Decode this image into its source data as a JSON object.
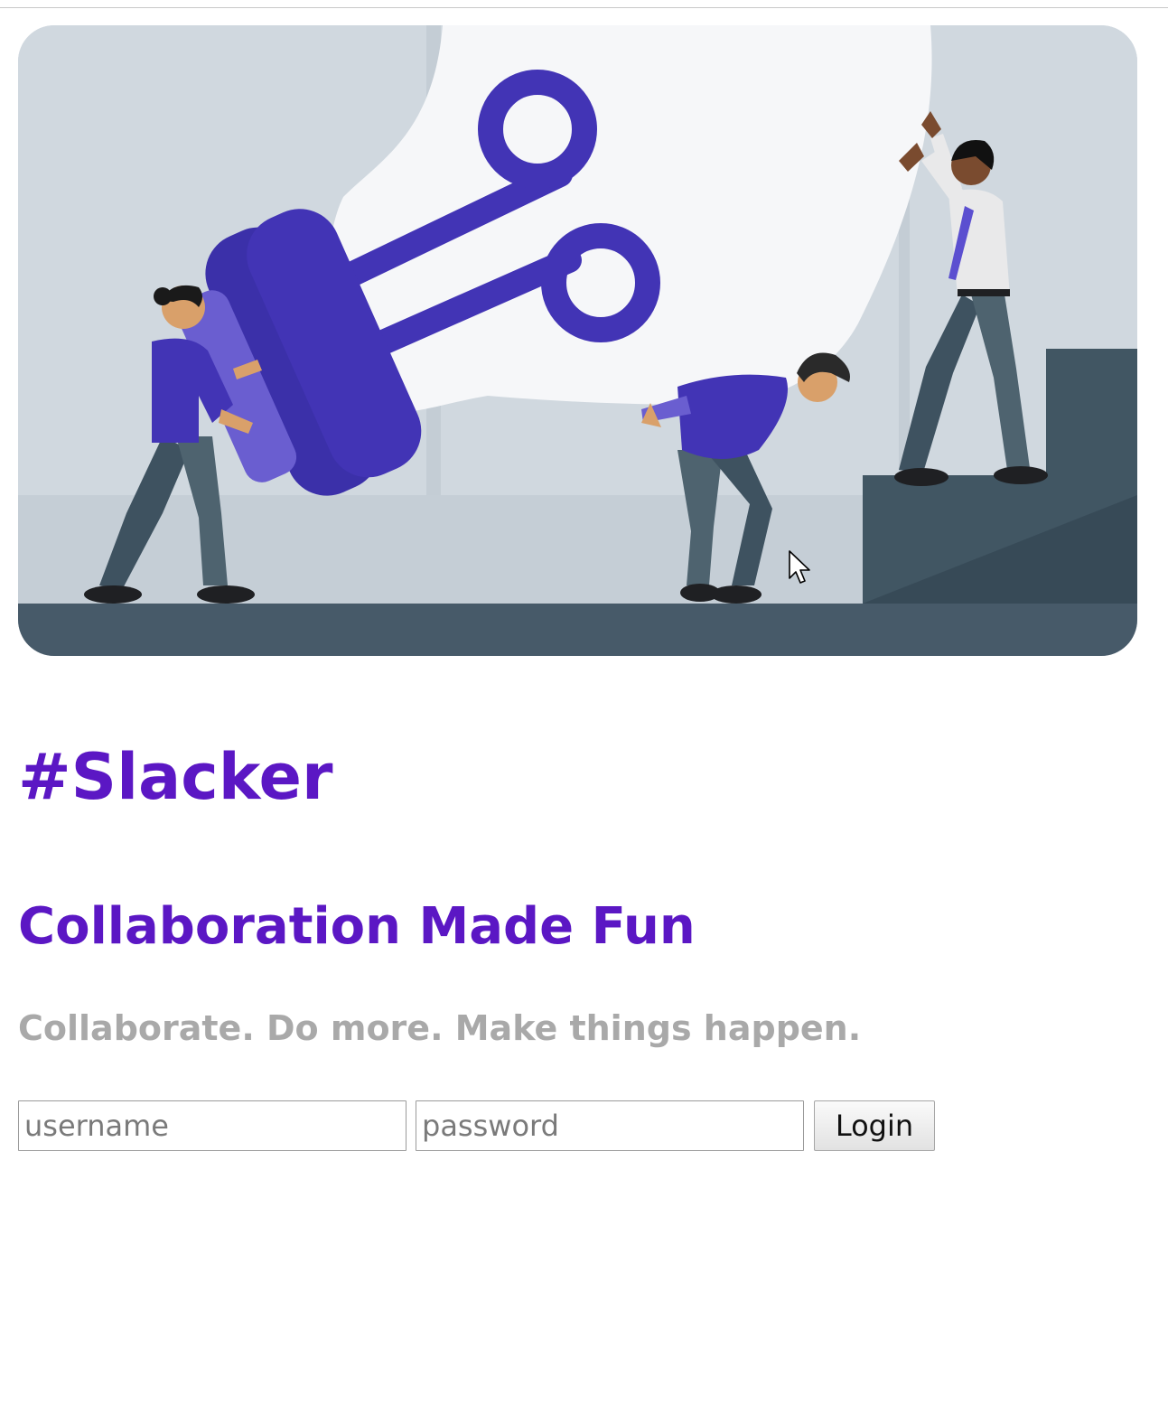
{
  "page": {
    "brand_title": "#Slacker",
    "tagline": "Collaboration Made Fun",
    "subline": "Collaborate. Do more. Make things happen."
  },
  "hero": {
    "image_name": "team-lifting-lightbulb-illustration",
    "colors": {
      "accent": "#4234b5",
      "background": "#cfd7de",
      "floor": "#475a69"
    }
  },
  "login": {
    "username_placeholder": "username",
    "password_placeholder": "password",
    "submit_label": "Login"
  },
  "colors": {
    "brand": "#5b17c4",
    "muted": "#a9a9a9"
  }
}
